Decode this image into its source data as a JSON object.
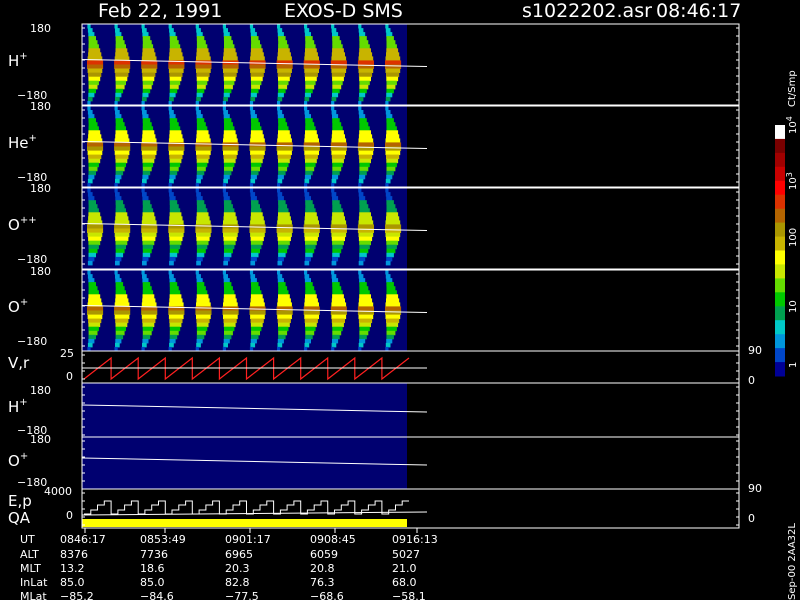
{
  "header": {
    "date": "Feb 22, 1991",
    "instrument": "EXOS-D SMS",
    "file": "s1022202.asr",
    "time": "08:46:17"
  },
  "colorbar": {
    "unit": "Ct/Smp",
    "ticks": [
      {
        "label": "1",
        "exp": ""
      },
      {
        "label": "10",
        "exp": ""
      },
      {
        "label": "100",
        "exp": ""
      },
      {
        "label": "10",
        "exp": "3"
      },
      {
        "label": "10",
        "exp": "4"
      }
    ],
    "colors": [
      "#000096",
      "#0046c8",
      "#0096dc",
      "#00c8c8",
      "#00a050",
      "#00c800",
      "#64dc00",
      "#c8e600",
      "#ffff00",
      "#c8b400",
      "#aa9600",
      "#b46400",
      "#dc3200",
      "#ff0000",
      "#c80000",
      "#a00000",
      "#780000",
      "#ffffff"
    ]
  },
  "panels": {
    "p1": {
      "label": "H",
      "sup": "+",
      "top": "180",
      "bottom": "−180"
    },
    "p2": {
      "label": "He",
      "sup": "+",
      "top": "180",
      "bottom": "−180"
    },
    "p3": {
      "label": "O",
      "sup": "++",
      "top": "180",
      "bottom": "−180"
    },
    "p4": {
      "label": "O",
      "sup": "+",
      "top": "180",
      "bottom": "−180"
    },
    "p5": {
      "label": "V,r",
      "top": "25",
      "bottom": "0",
      "right_top": "90",
      "right_bottom": "0"
    },
    "p6": {
      "label": "H",
      "sup": "+",
      "top": "180",
      "bottom": "−180"
    },
    "p7": {
      "label": "O",
      "sup": "+",
      "top": "180",
      "bottom": "−180"
    },
    "p8": {
      "label1": "E,p",
      "label2": "QA",
      "top": "4000",
      "bottom": "0",
      "right_top": "90",
      "right_bottom": "0"
    }
  },
  "chart_data": {
    "type": "heatmap",
    "x_ticks": [
      "0846:17",
      "0853:49",
      "0901:17",
      "0908:45",
      "0916:13"
    ],
    "y_range": [
      -180,
      180
    ],
    "sweep_count": 12,
    "colorbar_range": [
      1,
      10000
    ],
    "colorbar_scale": "log"
  },
  "footer": {
    "rows": [
      {
        "name": "UT",
        "values": [
          "0846:17",
          "0853:49",
          "0901:17",
          "0908:45",
          "0916:13"
        ]
      },
      {
        "name": "ALT",
        "values": [
          "8376",
          "7736",
          "6965",
          "6059",
          "5027"
        ]
      },
      {
        "name": "MLT",
        "values": [
          "13.2",
          "18.6",
          "20.3",
          "20.8",
          "21.0"
        ]
      },
      {
        "name": "InLat",
        "values": [
          "85.0",
          "85.0",
          "82.8",
          "76.3",
          "68.0"
        ]
      },
      {
        "name": "MLat",
        "values": [
          "−85.2",
          "−84.6",
          "−77.5",
          "−68.6",
          "−58.1"
        ]
      }
    ],
    "version": "Sep-00 2AA32L"
  }
}
